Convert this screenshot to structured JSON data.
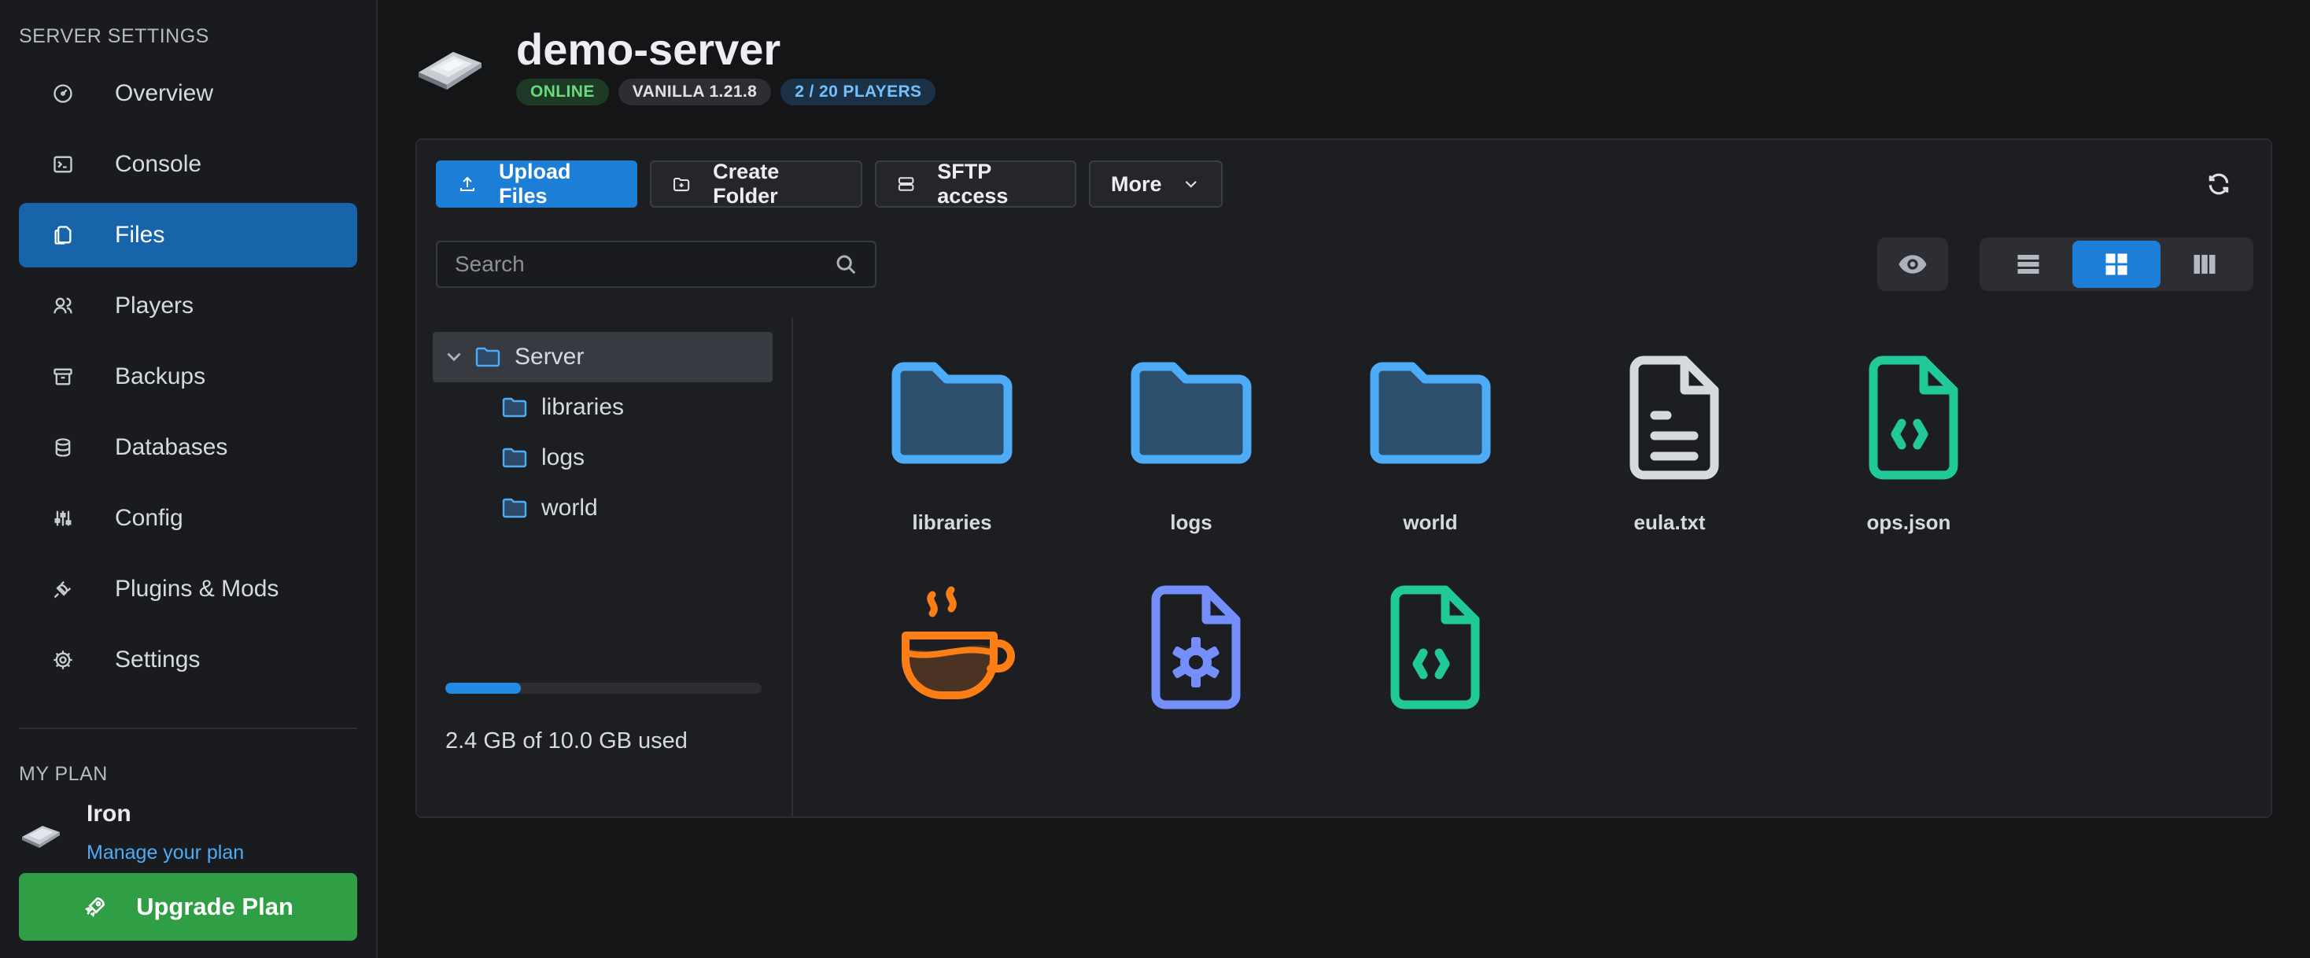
{
  "sidebar": {
    "section_title": "SERVER SETTINGS",
    "items": [
      {
        "label": "Overview",
        "icon": "gauge-icon",
        "active": false
      },
      {
        "label": "Console",
        "icon": "terminal-icon",
        "active": false
      },
      {
        "label": "Files",
        "icon": "files-icon",
        "active": true
      },
      {
        "label": "Players",
        "icon": "users-icon",
        "active": false
      },
      {
        "label": "Backups",
        "icon": "archive-icon",
        "active": false
      },
      {
        "label": "Databases",
        "icon": "database-icon",
        "active": false
      },
      {
        "label": "Config",
        "icon": "sliders-icon",
        "active": false
      },
      {
        "label": "Plugins & Mods",
        "icon": "plug-icon",
        "active": false
      },
      {
        "label": "Settings",
        "icon": "gear-icon",
        "active": false
      }
    ],
    "plan": {
      "heading": "MY PLAN",
      "name": "Iron",
      "manage_link": "Manage your plan",
      "upgrade_label": "Upgrade Plan"
    }
  },
  "header": {
    "title": "demo-server",
    "badges": {
      "status": "ONLINE",
      "version": "VANILLA 1.21.8",
      "players": "2 / 20 PLAYERS"
    }
  },
  "toolbar": {
    "upload_label": "Upload Files",
    "create_folder_label": "Create Folder",
    "sftp_label": "SFTP access",
    "more_label": "More"
  },
  "search": {
    "placeholder": "Search",
    "value": ""
  },
  "tree": {
    "root": "Server",
    "children": [
      "libraries",
      "logs",
      "world"
    ]
  },
  "storage": {
    "used_fraction": 0.24,
    "label": "2.4 GB of 10.0 GB used"
  },
  "files": [
    {
      "name": "libraries",
      "type": "folder",
      "icon": "folder-icon"
    },
    {
      "name": "logs",
      "type": "folder",
      "icon": "folder-icon"
    },
    {
      "name": "world",
      "type": "folder",
      "icon": "folder-icon"
    },
    {
      "name": "eula.txt",
      "type": "text",
      "icon": "text-file-icon"
    },
    {
      "name": "ops.json",
      "type": "json",
      "icon": "json-file-icon"
    },
    {
      "name": "",
      "type": "jar",
      "icon": "java-cup-icon"
    },
    {
      "name": "",
      "type": "properties",
      "icon": "settings-file-icon"
    },
    {
      "name": "",
      "type": "json",
      "icon": "json-file-icon"
    }
  ],
  "colors": {
    "accent": "#1c7ed6",
    "active_nav": "#1864ab",
    "folder": "#4dabf7",
    "json": "#20c997",
    "java": "#fd7e14",
    "settings_file": "#748ffc",
    "upgrade": "#2f9e44"
  }
}
